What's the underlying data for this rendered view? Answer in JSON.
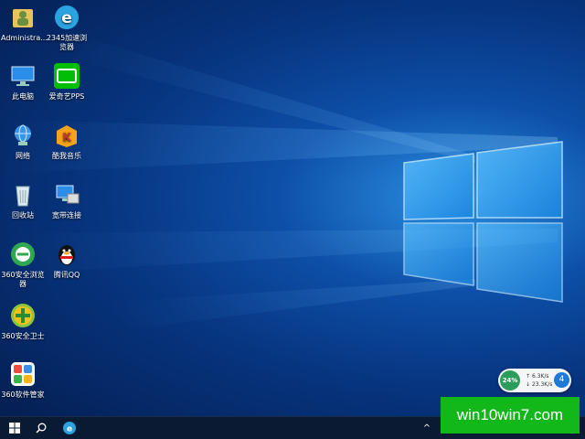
{
  "desktop_icons": [
    {
      "name": "icon-administrator",
      "label": "Administra..."
    },
    {
      "name": "icon-2345-browser",
      "label": "2345加速浏览器"
    },
    {
      "name": "icon-this-pc",
      "label": "此电脑"
    },
    {
      "name": "icon-iqiyi",
      "label": "爱奇艺PPS"
    },
    {
      "name": "icon-network",
      "label": "网络"
    },
    {
      "name": "icon-kuwo-music",
      "label": "酷我音乐"
    },
    {
      "name": "icon-recycle-bin",
      "label": "回收站"
    },
    {
      "name": "icon-broadband",
      "label": "宽带连接"
    },
    {
      "name": "icon-360-browser",
      "label": "360安全浏览器"
    },
    {
      "name": "icon-tencent-qq",
      "label": "腾讯QQ"
    },
    {
      "name": "icon-360-safe",
      "label": "360安全卫士"
    },
    {
      "name": "icon-360-software",
      "label": "360软件管家"
    }
  ],
  "net_widget": {
    "percent": "24%",
    "upload": "6.3K/s",
    "download": "23.3K/s",
    "badge": "4"
  },
  "taskbar": {
    "items": [
      "start-icon",
      "search-icon",
      "browser-icon"
    ],
    "tray_arrow": "^"
  },
  "watermark": {
    "text": "win10win7.com"
  },
  "colors": {
    "wallpaper_accent": "#2b8fe0",
    "taskbar": "#0b1a33",
    "widget_green": "#2a9d5b",
    "watermark_green": "#12b81a"
  }
}
